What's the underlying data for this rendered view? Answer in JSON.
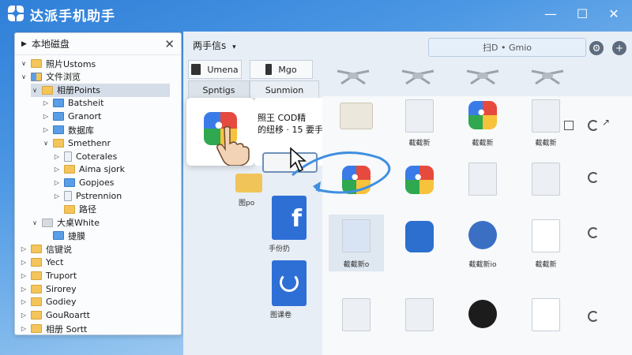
{
  "window": {
    "title": "达派手机助手",
    "minimize_icon": "minimize-icon",
    "maximize_icon": "maximize-icon",
    "close_icon": "close-icon"
  },
  "tree": {
    "header": "本地磁盘",
    "items": [
      {
        "label": "照片Ustoms",
        "toggle": "v",
        "icon": "yellow",
        "indent": 0
      },
      {
        "label": "文件浏览",
        "toggle": "v",
        "icon": "mix",
        "indent": 0
      },
      {
        "label": "相册Points",
        "toggle": "v",
        "icon": "yellow",
        "indent": 1,
        "selected": true
      },
      {
        "label": "Batsheit",
        "toggle": ">",
        "icon": "blue",
        "indent": 2
      },
      {
        "label": "Granort",
        "toggle": ">",
        "icon": "blue",
        "indent": 2
      },
      {
        "label": "数据库",
        "toggle": ">",
        "icon": "blue",
        "indent": 2
      },
      {
        "label": "Smethenr",
        "toggle": "v",
        "icon": "yellow",
        "indent": 2
      },
      {
        "label": "Coterales",
        "toggle": ">",
        "icon": "doc",
        "indent": 3
      },
      {
        "label": "Aima sjork",
        "toggle": ">",
        "icon": "yellow",
        "indent": 3
      },
      {
        "label": "Gopjoes",
        "toggle": ">",
        "icon": "blue",
        "indent": 3
      },
      {
        "label": "Pstrennion",
        "toggle": ">",
        "icon": "doc",
        "indent": 3
      },
      {
        "label": "路径",
        "toggle": "",
        "icon": "yellow",
        "indent": 3
      },
      {
        "label": "大桌White",
        "toggle": "v",
        "icon": "grey",
        "indent": 1
      },
      {
        "label": "捷膜",
        "toggle": "",
        "icon": "blue",
        "indent": 2
      },
      {
        "label": "信键说",
        "toggle": ">",
        "icon": "yellow",
        "indent": 0
      },
      {
        "label": "Yect",
        "toggle": ">",
        "icon": "yellow",
        "indent": 0
      },
      {
        "label": "Truport",
        "toggle": ">",
        "icon": "yellow",
        "indent": 0
      },
      {
        "label": "Sirorey",
        "toggle": ">",
        "icon": "yellow",
        "indent": 0
      },
      {
        "label": "Godiey",
        "toggle": ">",
        "icon": "yellow",
        "indent": 0
      },
      {
        "label": "GouRoartt",
        "toggle": ">",
        "icon": "yellow",
        "indent": 0
      },
      {
        "label": "相册 Sortt",
        "toggle": ">",
        "icon": "yellow",
        "indent": 0
      }
    ]
  },
  "main": {
    "breadcrumb": "两手信s",
    "breadcrumb_dropdown": "▾",
    "search_placeholder": "扫D • Gmio",
    "tabs": [
      {
        "label": "Umena"
      },
      {
        "label": "Mgo"
      },
      {
        "label": "Spntigs"
      },
      {
        "label": "Sunmion"
      }
    ],
    "popup_text_line1": "照王 COD精",
    "popup_text_line2": "的纽移 · 15",
    "popup_text_line3": "要手",
    "side_label_1": "图po",
    "side_label_2": "手份扔",
    "side_label_3": "图课卷",
    "grid_labels": {
      "r1c2": "截截新",
      "r1c3": "截截新",
      "r1c4": "截截新",
      "r3c1": "截截新o",
      "r3c3": "截截新io",
      "r3c4": "截截新"
    }
  }
}
